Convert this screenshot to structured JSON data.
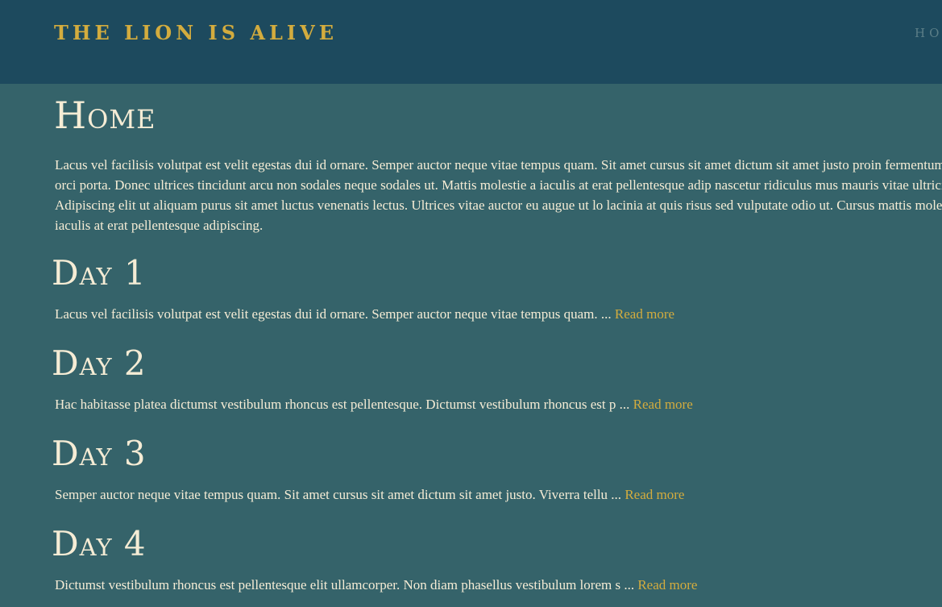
{
  "header": {
    "site_title": "THE LION IS ALIVE",
    "nav_partial": "HO"
  },
  "main": {
    "page_title": "Home",
    "intro": "Lacus vel facilisis volutpat est velit egestas dui id ornare. Semper auctor neque vitae tempus quam. Sit amet cursus sit amet dictum sit amet justo proin fermentum leo vel orci porta. Donec ultrices tincidunt arcu non sodales neque sodales ut. Mattis molestie a iaculis at erat pellentesque adip nascetur ridiculus mus mauris vitae ultricies. Adipiscing elit ut aliquam purus sit amet luctus venenatis lectus. Ultrices vitae auctor eu augue ut lo lacinia at quis risus sed vulputate odio ut. Cursus mattis molestie a iaculis at erat pellentesque adipiscing.",
    "posts": [
      {
        "title": "Day 1",
        "excerpt": "Lacus vel facilisis volutpat est velit egestas dui id ornare. Semper auctor neque vitae tempus quam. ...",
        "read_more": "Read more"
      },
      {
        "title": "Day 2",
        "excerpt": "Hac habitasse platea dictumst vestibulum rhoncus est pellentesque. Dictumst vestibulum rhoncus est p ...",
        "read_more": "Read more"
      },
      {
        "title": "Day 3",
        "excerpt": "Semper auctor neque vitae tempus quam. Sit amet cursus sit amet dictum sit amet justo. Viverra tellu ...",
        "read_more": "Read more"
      },
      {
        "title": "Day 4",
        "excerpt": "Dictumst vestibulum rhoncus est pellentesque elit ullamcorper. Non diam phasellus vestibulum lorem s ...",
        "read_more": "Read more"
      }
    ]
  },
  "colors": {
    "header_bg": "#1d4a5e",
    "content_bg": "#35636a",
    "accent_gold": "#d3ac3e",
    "text_cream": "#f5ecd5"
  }
}
